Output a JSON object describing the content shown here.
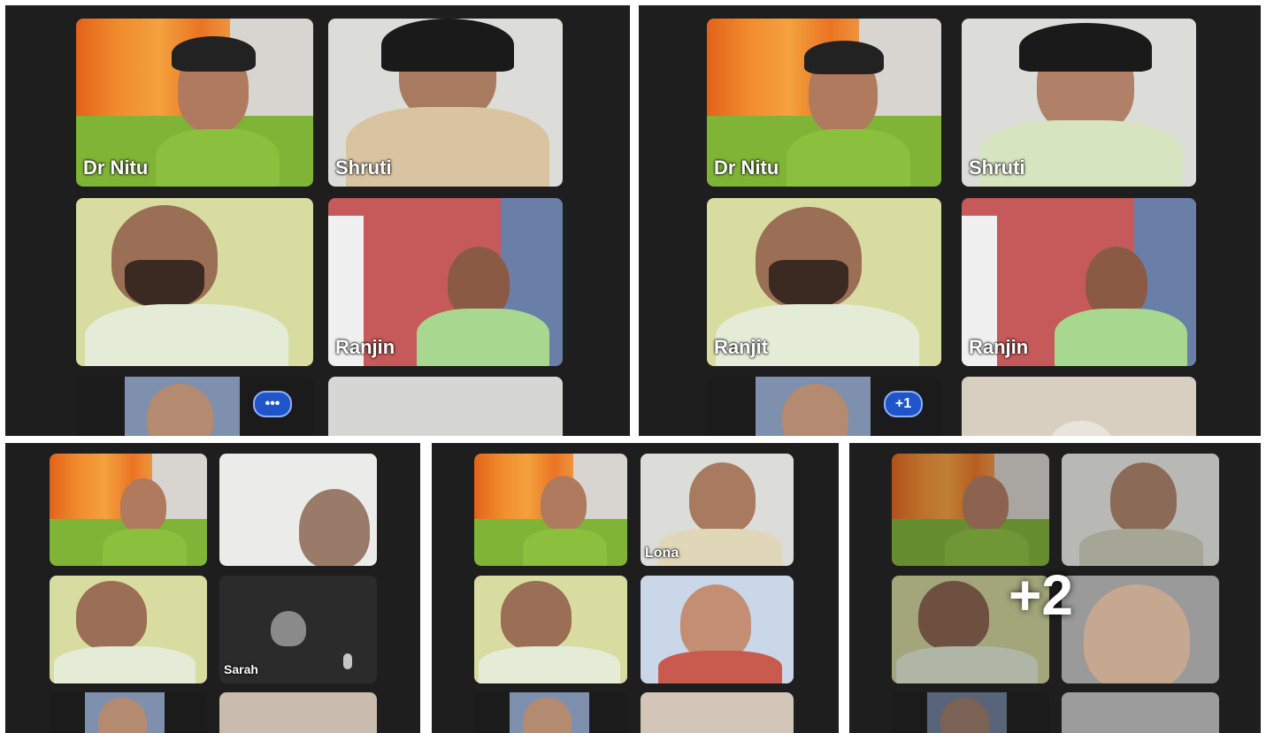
{
  "screenshots": [
    {
      "id": "a",
      "tiles": [
        {
          "name": "Dr Nitu"
        },
        {
          "name": "Shruti"
        },
        {
          "name": ""
        },
        {
          "name": "Ranjin"
        },
        {
          "name": ""
        },
        {
          "name": ""
        }
      ],
      "more_label": "•••"
    },
    {
      "id": "b",
      "tiles": [
        {
          "name": "Dr Nitu"
        },
        {
          "name": "Shruti"
        },
        {
          "name": "Ranjit"
        },
        {
          "name": "Ranjin"
        },
        {
          "name": ""
        },
        {
          "name": ""
        }
      ],
      "more_label": "+1"
    },
    {
      "id": "c",
      "tiles": [
        {
          "name": ""
        },
        {
          "name": ""
        },
        {
          "name": ""
        },
        {
          "name": "Sarah"
        },
        {
          "name": ""
        },
        {
          "name": ""
        }
      ]
    },
    {
      "id": "d",
      "tiles": [
        {
          "name": ""
        },
        {
          "name": "Lona"
        },
        {
          "name": ""
        },
        {
          "name": ""
        },
        {
          "name": ""
        },
        {
          "name": ""
        }
      ]
    },
    {
      "id": "e",
      "tiles": [
        {
          "name": ""
        },
        {
          "name": ""
        },
        {
          "name": ""
        },
        {
          "name": ""
        },
        {
          "name": ""
        },
        {
          "name": ""
        }
      ],
      "overlay_count": "+2"
    }
  ],
  "colors": {
    "panel_bg": "#1e1e1e",
    "curtain": "#f18b2c",
    "shirt_green": "#7fb437",
    "more_button": "#1f55c9"
  }
}
